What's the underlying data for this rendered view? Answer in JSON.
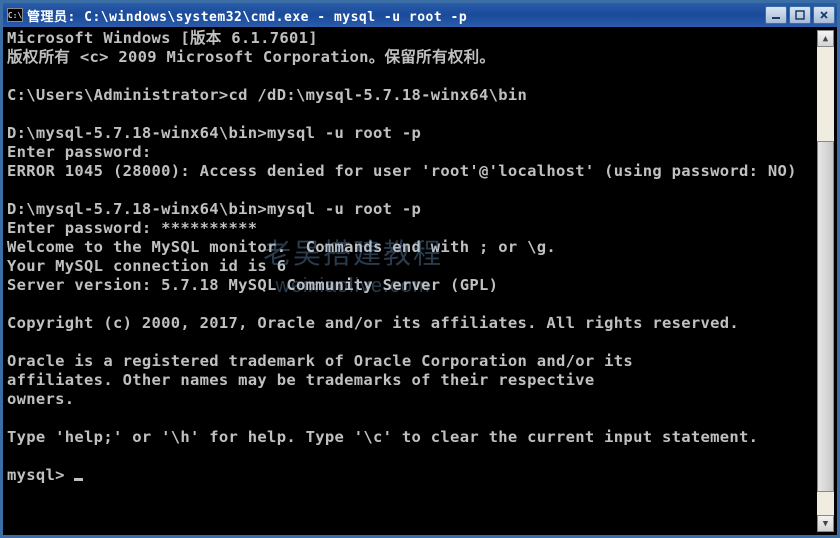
{
  "titlebar": {
    "icon_text": "C:\\",
    "title": "管理员: C:\\windows\\system32\\cmd.exe - mysql  -u root -p"
  },
  "terminal": {
    "lines": [
      "Microsoft Windows [版本 6.1.7601]",
      "版权所有 <c> 2009 Microsoft Corporation。保留所有权利。",
      "",
      "C:\\Users\\Administrator>cd /dD:\\mysql-5.7.18-winx64\\bin",
      "",
      "D:\\mysql-5.7.18-winx64\\bin>mysql -u root -p",
      "Enter password:",
      "ERROR 1045 (28000): Access denied for user 'root'@'localhost' (using password: NO)",
      "",
      "D:\\mysql-5.7.18-winx64\\bin>mysql -u root -p",
      "Enter password: **********",
      "Welcome to the MySQL monitor.  Commands end with ; or \\g.",
      "Your MySQL connection id is 6",
      "Server version: 5.7.18 MySQL Community Server (GPL)",
      "",
      "Copyright (c) 2000, 2017, Oracle and/or its affiliates. All rights reserved.",
      "",
      "Oracle is a registered trademark of Oracle Corporation and/or its",
      "affiliates. Other names may be trademarks of their respective",
      "owners.",
      "",
      "Type 'help;' or '\\h' for help. Type '\\c' to clear the current input statement.",
      "",
      "mysql> "
    ]
  },
  "watermark": {
    "line1": "老吴搭建教程",
    "line2": "weixiaolive.com"
  },
  "colors": {
    "titlebar_bg": "#2a5caa",
    "terminal_bg": "#000000",
    "terminal_fg": "#c0c0c0"
  }
}
